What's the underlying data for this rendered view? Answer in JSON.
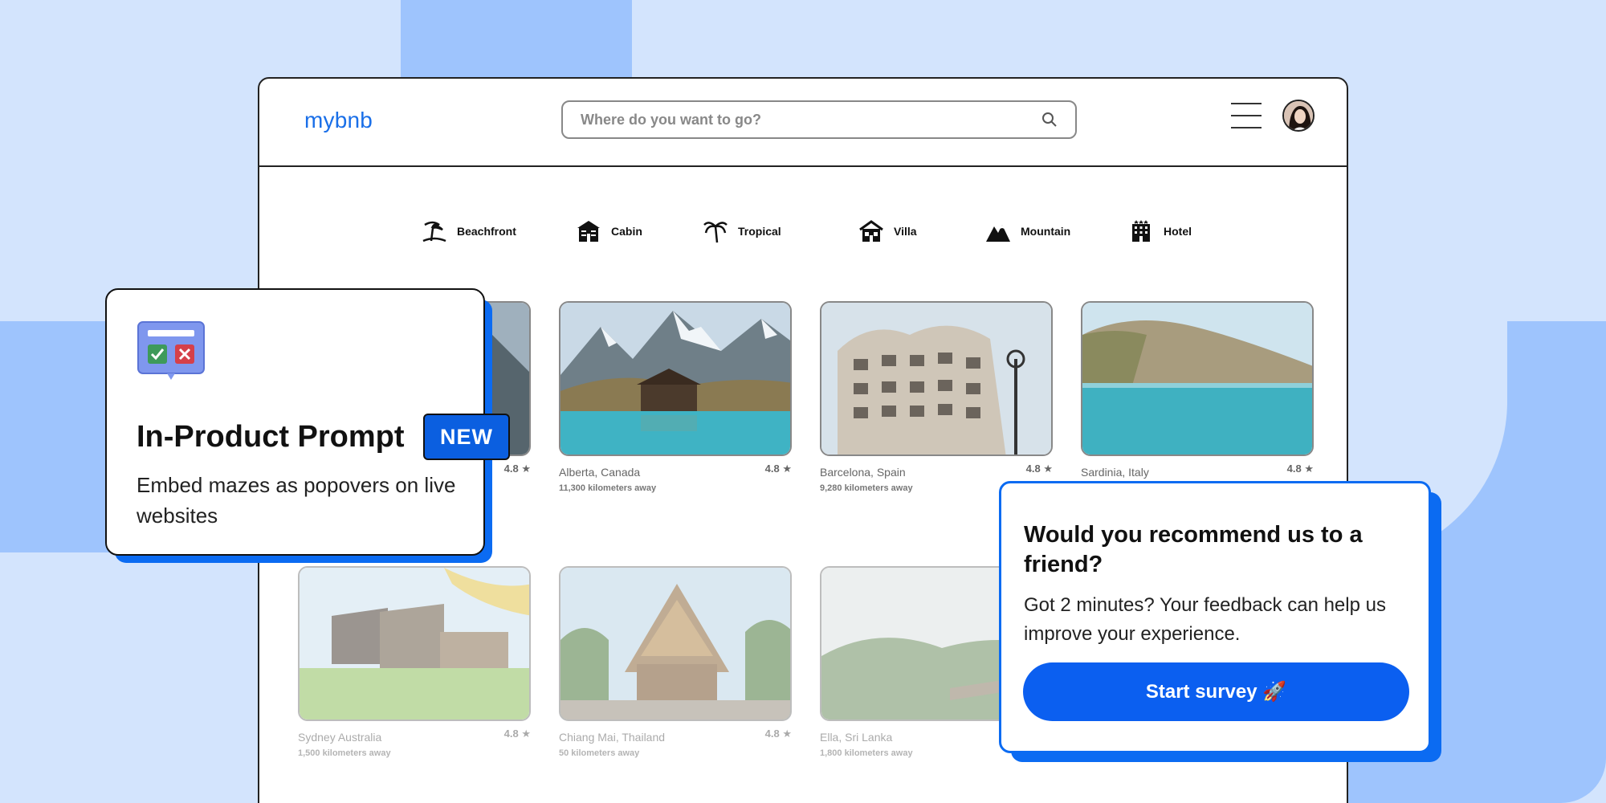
{
  "app": {
    "logo": "mybnb"
  },
  "search": {
    "placeholder": "Where do you want to go?"
  },
  "categories": [
    {
      "label": "Beachfront",
      "icon": "beachfront-icon"
    },
    {
      "label": "Cabin",
      "icon": "cabin-icon"
    },
    {
      "label": "Tropical",
      "icon": "palm-tree-icon"
    },
    {
      "label": "Villa",
      "icon": "villa-icon"
    },
    {
      "label": "Mountain",
      "icon": "mountain-icon"
    },
    {
      "label": "Hotel",
      "icon": "hotel-icon"
    }
  ],
  "listings": [
    {
      "rating": "4.8"
    },
    {
      "title": "Alberta, Canada",
      "distance": "11,300 kilometers away",
      "rating": "4.8"
    },
    {
      "title": "Barcelona, Spain",
      "distance": "9,280 kilometers away",
      "rating": "4.8"
    },
    {
      "title": "Sardinia, Italy",
      "distance": "",
      "rating": "4.8"
    },
    {
      "title": "Sydney Australia",
      "distance": "1,500 kilometers away",
      "rating": "4.8"
    },
    {
      "title": "Chiang Mai, Thailand",
      "distance": "50 kilometers away",
      "rating": "4.8"
    },
    {
      "title": "Ella, Sri Lanka",
      "distance": "1,800 kilometers away",
      "rating": ""
    }
  ],
  "prompt_card": {
    "title": "In-Product Prompt",
    "badge": "NEW",
    "description": "Embed mazes as popovers on live websites"
  },
  "survey_card": {
    "title": "Would you recommend us to a friend?",
    "description": "Got 2 minutes? Your feedback can help us improve your experience.",
    "button": "Start survey 🚀"
  },
  "colors": {
    "accent": "#0b5ff0",
    "background": "#d3e4fd",
    "logo": "#1a6fe8"
  }
}
